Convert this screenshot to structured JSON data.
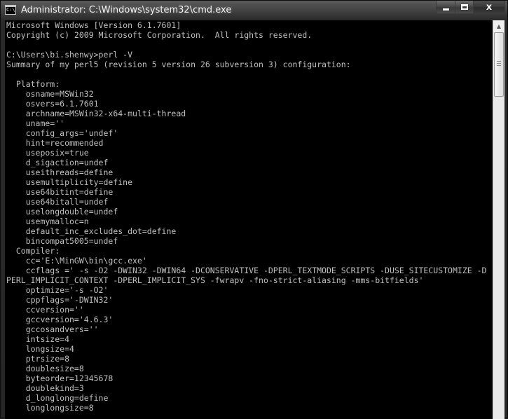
{
  "window": {
    "title": "Administrator: C:\\Windows\\system32\\cmd.exe",
    "icon_text": "C:\\."
  },
  "controls": {
    "minimize": "minimize",
    "maximize": "maximize",
    "close": "x"
  },
  "console": {
    "lines": [
      "Microsoft Windows [Version 6.1.7601]",
      "Copyright (c) 2009 Microsoft Corporation.  All rights reserved.",
      "",
      "C:\\Users\\bi.shenwy>perl -V",
      "Summary of my perl5 (revision 5 version 26 subversion 3) configuration:",
      "",
      "  Platform:",
      "    osname=MSWin32",
      "    osvers=6.1.7601",
      "    archname=MSWin32-x64-multi-thread",
      "    uname=''",
      "    config_args='undef'",
      "    hint=recommended",
      "    useposix=true",
      "    d_sigaction=undef",
      "    useithreads=define",
      "    usemultiplicity=define",
      "    use64bitint=define",
      "    use64bitall=undef",
      "    uselongdouble=undef",
      "    usemymalloc=n",
      "    default_inc_excludes_dot=define",
      "    bincompat5005=undef",
      "  Compiler:",
      "    cc='E:\\MinGW\\bin\\gcc.exe'",
      "    ccflags =' -s -O2 -DWIN32 -DWIN64 -DCONSERVATIVE -DPERL_TEXTMODE_SCRIPTS -DUSE_SITECUSTOMIZE -D",
      "PERL_IMPLICIT_CONTEXT -DPERL_IMPLICIT_SYS -fwrapv -fno-strict-aliasing -mms-bitfields'",
      "    optimize='-s -O2'",
      "    cppflags='-DWIN32'",
      "    ccversion=''",
      "    gccversion='4.6.3'",
      "    gccosandvers=''",
      "    intsize=4",
      "    longsize=4",
      "    ptrsize=8",
      "    doublesize=8",
      "    byteorder=12345678",
      "    doublekind=3",
      "    d_longlong=define",
      "    longlongsize=8"
    ]
  },
  "scrollbar": {
    "up_arrow": "▲"
  }
}
